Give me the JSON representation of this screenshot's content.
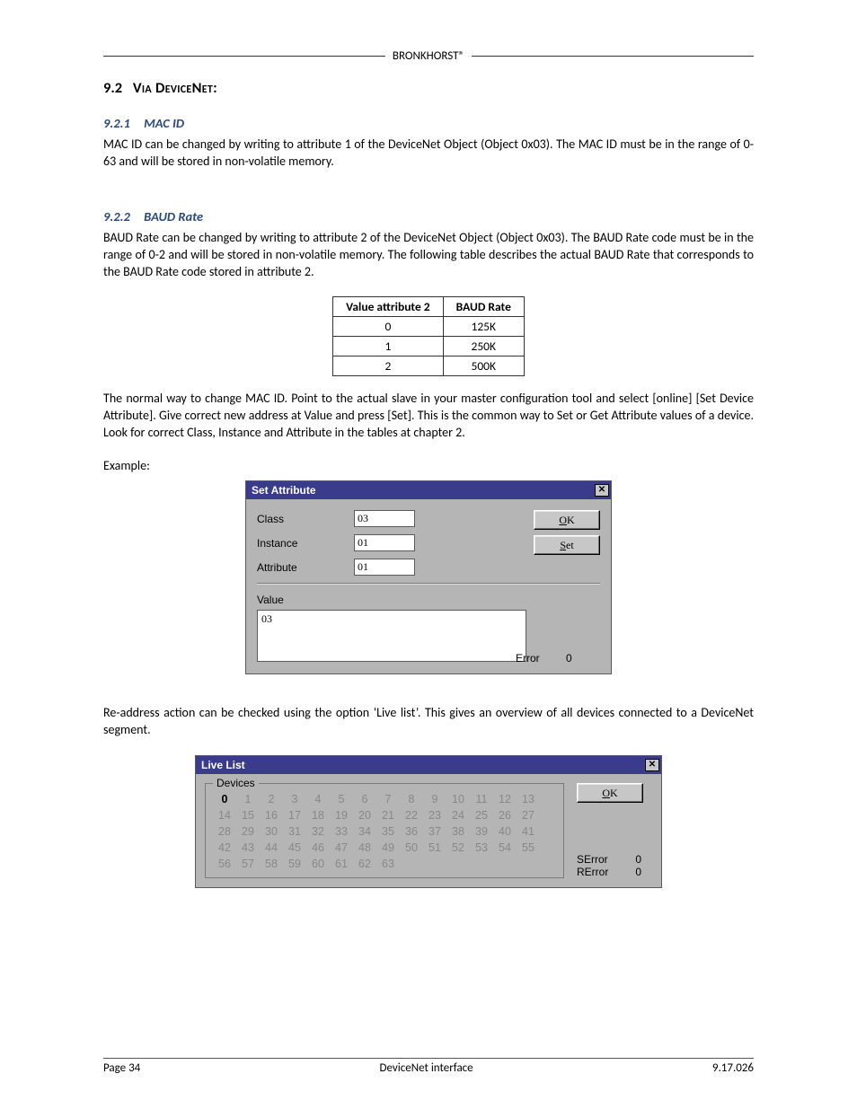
{
  "header": {
    "brand": "BRONKHORST®"
  },
  "section": {
    "number": "9.2",
    "title": "Via DeviceNet:"
  },
  "sub1": {
    "number": "9.2.1",
    "title": "MAC ID",
    "body": "MAC ID can be changed by writing to attribute 1 of the DeviceNet Object (Object 0x03). The MAC ID must be in the range of 0-63 and will be stored in non-volatile memory."
  },
  "sub2": {
    "number": "9.2.2",
    "title": "BAUD Rate",
    "body": "BAUD Rate can be changed by writing to attribute 2 of the DeviceNet Object (Object 0x03). The BAUD Rate code must be in the range of 0-2 and will be stored in non-volatile memory. The following table describes the actual BAUD Rate that corresponds to the BAUD Rate code stored in attribute 2."
  },
  "baud_table": {
    "head": {
      "c1": "Value attribute 2",
      "c2": "BAUD Rate"
    },
    "rows": [
      {
        "c1": "0",
        "c2": "125K"
      },
      {
        "c1": "1",
        "c2": "250K"
      },
      {
        "c1": "2",
        "c2": "500K"
      }
    ]
  },
  "para_after_table": "The normal way to change MAC ID. Point to the actual slave in your master configuration tool and select [online] [Set Device Attribute]. Give correct new address at Value and press [Set]. This is the common way to Set or Get Attribute values of a device. Look for correct Class, Instance and Attribute in the tables at chapter 2.",
  "example_label": "Example:",
  "dialog_set_attr": {
    "title": "Set Attribute",
    "labels": {
      "class": "Class",
      "instance": "Instance",
      "attribute": "Attribute",
      "value": "Value"
    },
    "values": {
      "class": "03",
      "instance": "01",
      "attribute": "01",
      "value": "03"
    },
    "buttons": {
      "ok": "OK",
      "set": "Set"
    },
    "error": {
      "label": "Error",
      "value": "0"
    }
  },
  "para_after_dlg1": "Re-address action can be checked using the option ‘Live list’. This gives an overview of all devices connected to a DeviceNet segment.",
  "dialog_live_list": {
    "title": "Live List",
    "group_label": "Devices",
    "active": [
      0
    ],
    "buttons": {
      "ok": "OK"
    },
    "errors": {
      "serror_label": "SError",
      "serror_value": "0",
      "rerror_label": "RError",
      "rerror_value": "0"
    }
  },
  "footer": {
    "left": "Page 34",
    "center": "DeviceNet interface",
    "right": "9.17.026"
  }
}
